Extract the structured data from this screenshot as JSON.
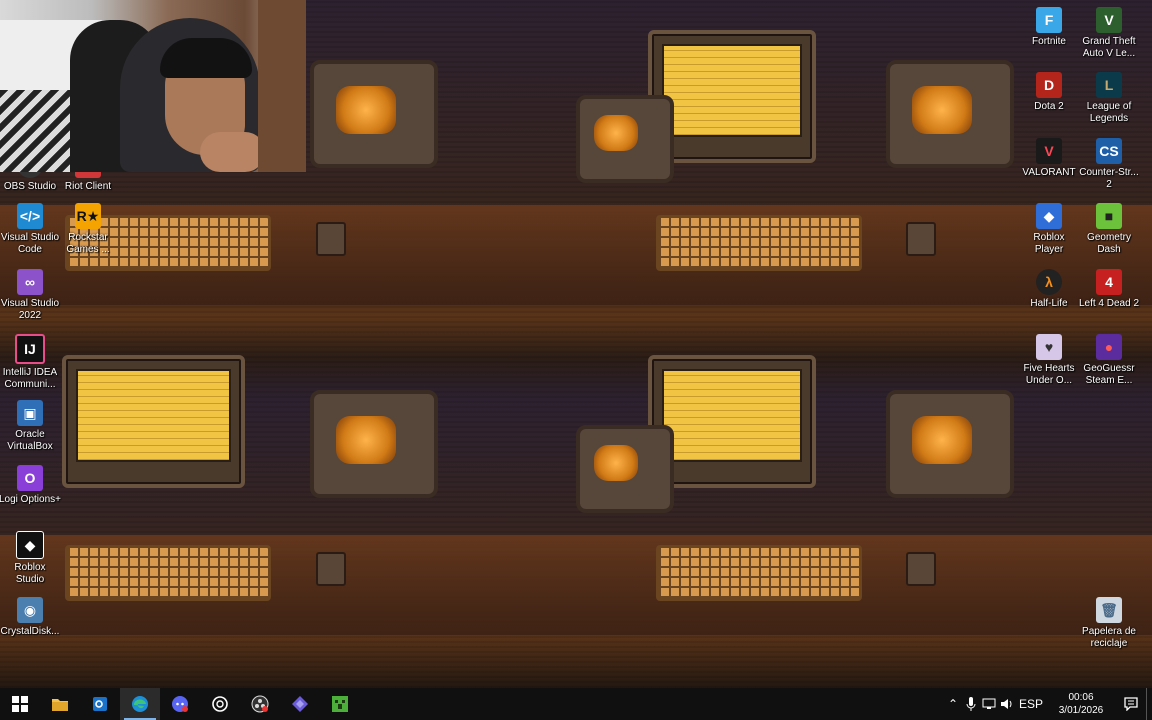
{
  "desktop_left": [
    {
      "label": "OBS Studio",
      "icon": "obs-icon"
    },
    {
      "label": "Riot Client",
      "icon": "riot-icon"
    },
    {
      "label": "Visual Studio Code",
      "icon": "vscode-icon"
    },
    {
      "label": "Rockstar Games ...",
      "icon": "rockstar-icon"
    },
    {
      "label": "Visual Studio 2022",
      "icon": "visual-studio-icon"
    },
    {
      "label": "IntelliJ IDEA Communi...",
      "icon": "intellij-icon"
    },
    {
      "label": "Oracle VirtualBox",
      "icon": "virtualbox-icon"
    },
    {
      "label": "Logi Options+",
      "icon": "logi-icon"
    },
    {
      "label": "Roblox Studio",
      "icon": "roblox-studio-icon"
    },
    {
      "label": "CrystalDisk...",
      "icon": "crystaldisk-icon"
    }
  ],
  "desktop_right": [
    {
      "label": "Fortnite",
      "icon": "fortnite-icon"
    },
    {
      "label": "Grand Theft Auto V Le...",
      "icon": "gta-v-icon"
    },
    {
      "label": "Dota 2",
      "icon": "dota2-icon"
    },
    {
      "label": "League of Legends",
      "icon": "lol-icon"
    },
    {
      "label": "VALORANT",
      "icon": "valorant-icon"
    },
    {
      "label": "Counter-Str... 2",
      "icon": "counter-strike-icon"
    },
    {
      "label": "Roblox Player",
      "icon": "roblox-icon"
    },
    {
      "label": "Geometry Dash",
      "icon": "geometry-dash-icon"
    },
    {
      "label": "Half-Life",
      "icon": "half-life-icon"
    },
    {
      "label": "Left 4 Dead 2",
      "icon": "left4dead-icon"
    },
    {
      "label": "Five Hearts Under O...",
      "icon": "five-hearts-icon"
    },
    {
      "label": "GeoGuessr Steam E...",
      "icon": "geoguessr-icon"
    },
    {
      "label": "Papelera de reciclaje",
      "icon": "recycle-bin-icon"
    }
  ],
  "taskbar": {
    "apps": [
      {
        "icon": "start-icon"
      },
      {
        "icon": "file-explorer-icon"
      },
      {
        "icon": "outlook-icon"
      },
      {
        "icon": "edge-icon"
      },
      {
        "icon": "discord-icon"
      },
      {
        "icon": "chatgpt-icon"
      },
      {
        "icon": "obs-taskbar-icon"
      },
      {
        "icon": "visual-studio-taskbar-icon"
      },
      {
        "icon": "minecraft-icon"
      }
    ],
    "language": "ESP",
    "time": "00:06",
    "date": "3/01/2026"
  }
}
